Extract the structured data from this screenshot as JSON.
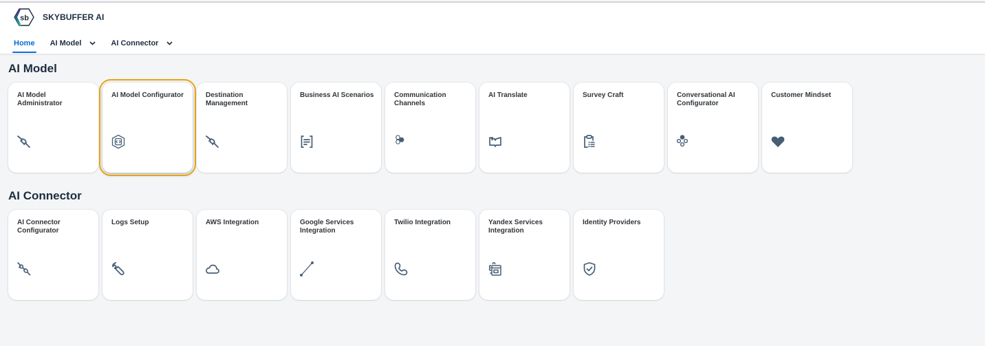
{
  "app": {
    "brand_name": "SKYBUFFER AI",
    "logo_text": "sb"
  },
  "nav": {
    "items": [
      {
        "label": "Home",
        "active": true,
        "has_dropdown": false
      },
      {
        "label": "AI Model",
        "active": false,
        "has_dropdown": true
      },
      {
        "label": "AI Connector",
        "active": false,
        "has_dropdown": true
      }
    ]
  },
  "colors": {
    "accent": "#0a6ed1",
    "focus": "#e9a414",
    "icon": "#475e75",
    "background": "#f4f5f7"
  },
  "sections": [
    {
      "title": "AI Model",
      "tiles": [
        {
          "title": "AI Model Administrator",
          "icon": "plug-disconnected-icon",
          "focused": false
        },
        {
          "title": "AI Model Configurator",
          "icon": "hexagon-code-icon",
          "focused": true
        },
        {
          "title": "Destination Management",
          "icon": "plug-disconnected-icon",
          "focused": false
        },
        {
          "title": "Business AI Scenarios",
          "icon": "document-text-icon",
          "focused": false
        },
        {
          "title": "Communication Channels",
          "icon": "hexagons-icon",
          "focused": false
        },
        {
          "title": "AI Translate",
          "icon": "open-book-icon",
          "focused": false
        },
        {
          "title": "Survey Craft",
          "icon": "clipboard-list-icon",
          "focused": false
        },
        {
          "title": "Conversational AI Configurator",
          "icon": "nodes-icon",
          "focused": false
        },
        {
          "title": "Customer Mindset",
          "icon": "heart-icon",
          "focused": false
        }
      ]
    },
    {
      "title": "AI Connector",
      "tiles": [
        {
          "title": "AI Connector Configurator",
          "icon": "plug-connect-icon",
          "focused": false
        },
        {
          "title": "Logs Setup",
          "icon": "wrench-icon",
          "focused": false
        },
        {
          "title": "AWS Integration",
          "icon": "cloud-icon",
          "focused": false
        },
        {
          "title": "Google Services Integration",
          "icon": "line-icon",
          "focused": false
        },
        {
          "title": "Twilio Integration",
          "icon": "phone-icon",
          "focused": false
        },
        {
          "title": "Yandex Services Integration",
          "icon": "gear-window-icon",
          "focused": false
        },
        {
          "title": "Identity Providers",
          "icon": "shield-check-icon",
          "focused": false
        }
      ]
    }
  ]
}
